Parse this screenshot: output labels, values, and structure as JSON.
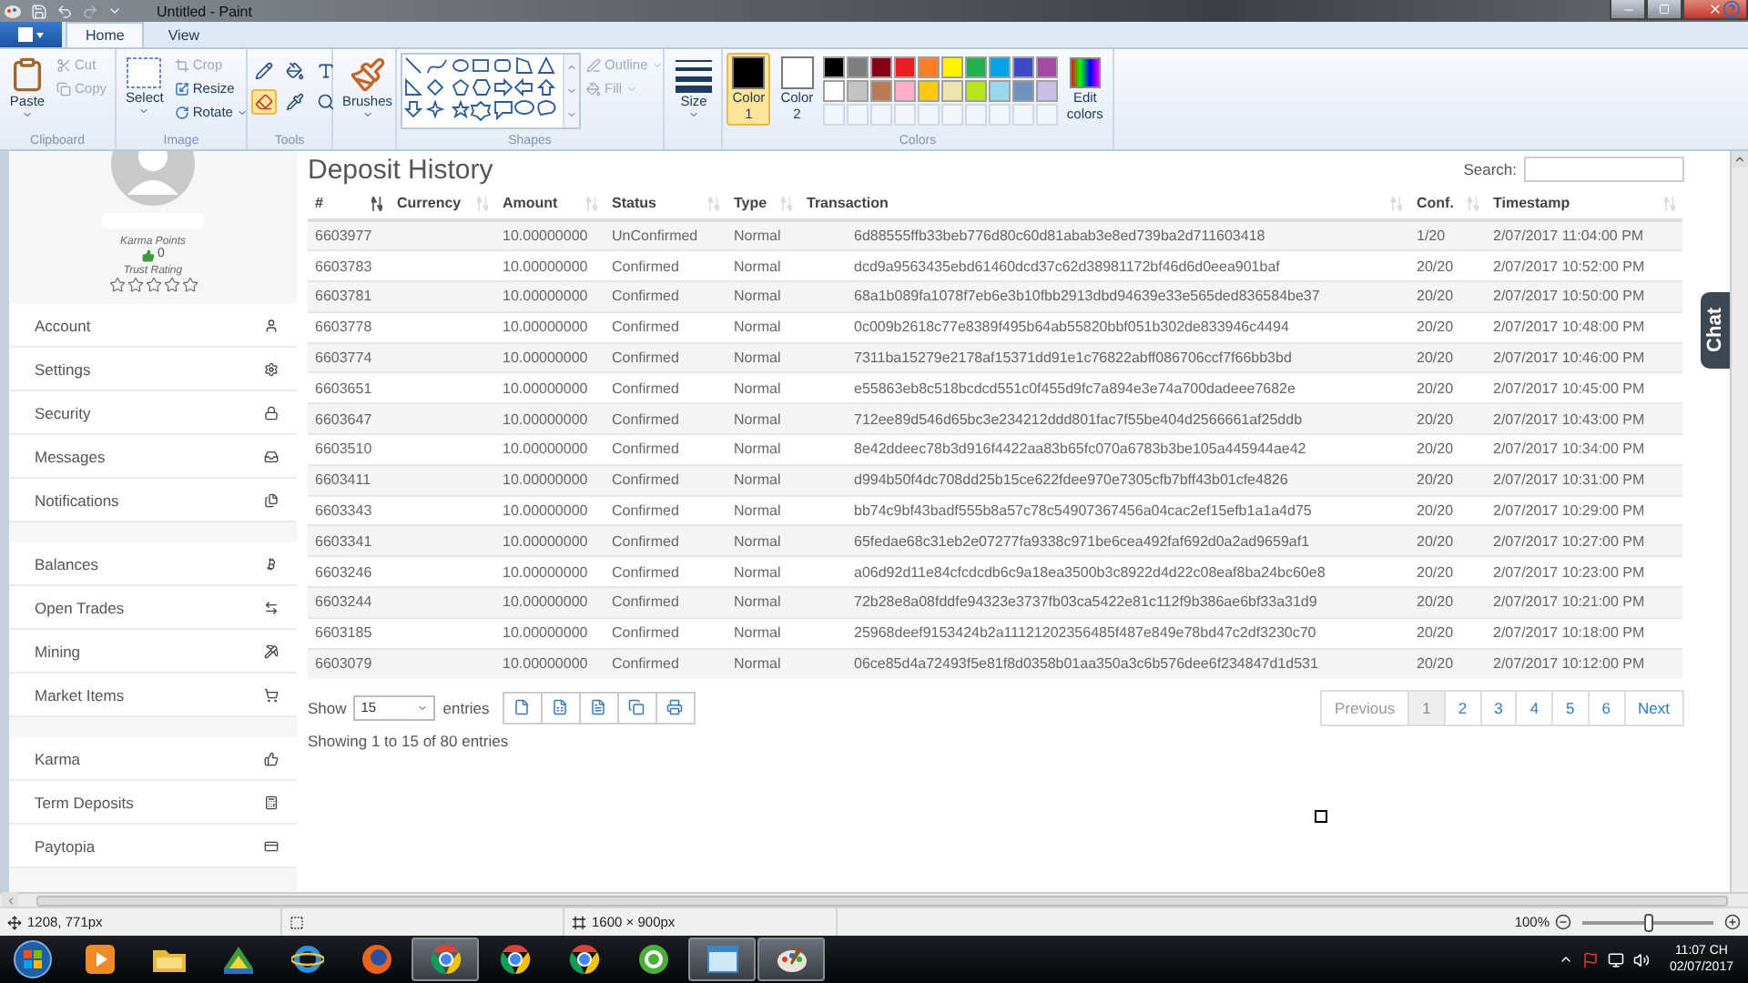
{
  "window": {
    "title": "Untitled - Paint"
  },
  "tabs": [
    {
      "label": "Home",
      "selected": true
    },
    {
      "label": "View",
      "selected": false
    }
  ],
  "ribbon": {
    "clipboard": {
      "label": "Clipboard",
      "paste": "Paste",
      "cut": {
        "label": "Cut",
        "disabled": true
      },
      "copy": {
        "label": "Copy",
        "disabled": true
      }
    },
    "image": {
      "label": "Image",
      "select": "Select",
      "crop": "Crop",
      "resize": "Resize",
      "rotate": "Rotate"
    },
    "tools": {
      "label": "Tools",
      "items": [
        {
          "kind": "pencil",
          "selected": false
        },
        {
          "kind": "fill",
          "selected": false
        },
        {
          "kind": "text",
          "selected": false
        },
        {
          "kind": "eraser",
          "selected": true
        },
        {
          "kind": "picker",
          "selected": false
        },
        {
          "kind": "magnifier",
          "selected": false
        }
      ]
    },
    "brushes": "Brushes",
    "shapes": {
      "label": "Shapes",
      "outline": {
        "label": "Outline",
        "disabled": true
      },
      "fill": {
        "label": "Fill",
        "disabled": true
      }
    },
    "size": "Size",
    "colors": {
      "label": "Colors",
      "color1": {
        "label": "Color 1",
        "color": "#000000",
        "selected": true
      },
      "color2": {
        "label": "Color 2",
        "color": "#ffffff",
        "selected": false
      },
      "palette": [
        {
          "color": "#000000"
        },
        {
          "color": "#7f7f7f"
        },
        {
          "color": "#880015"
        },
        {
          "color": "#ed1c24"
        },
        {
          "color": "#ff7f27"
        },
        {
          "color": "#fff200"
        },
        {
          "color": "#22b14c"
        },
        {
          "color": "#00a2e8"
        },
        {
          "color": "#3f48cc"
        },
        {
          "color": "#a349a4"
        },
        {
          "color": "#ffffff"
        },
        {
          "color": "#c3c3c3"
        },
        {
          "color": "#b97a57"
        },
        {
          "color": "#ffaec9"
        },
        {
          "color": "#ffc90e"
        },
        {
          "color": "#efe4b0"
        },
        {
          "color": "#b5e61d"
        },
        {
          "color": "#99d9ea"
        },
        {
          "color": "#7092be"
        },
        {
          "color": "#c8bfe7"
        }
      ],
      "edit": "Edit colors"
    }
  },
  "page": {
    "title": "Deposit History",
    "search_label": "Search:",
    "sidebar": {
      "karma": {
        "label": "Karma Points",
        "value": "0"
      },
      "trust": {
        "label": "Trust Rating",
        "stars": 0
      },
      "menu_groups": [
        {
          "items": [
            {
              "label": "Account",
              "kind": "user"
            },
            {
              "label": "Settings",
              "kind": "settings"
            },
            {
              "label": "Security",
              "kind": "security"
            },
            {
              "label": "Messages",
              "kind": "messages"
            },
            {
              "label": "Notifications",
              "kind": "notifications"
            }
          ]
        },
        {
          "items": [
            {
              "label": "Balances",
              "kind": "balances"
            },
            {
              "label": "Open Trades",
              "kind": "trades"
            },
            {
              "label": "Mining",
              "kind": "mining"
            },
            {
              "label": "Market Items",
              "kind": "market"
            }
          ]
        },
        {
          "items": [
            {
              "label": "Karma",
              "kind": "karma"
            },
            {
              "label": "Term Deposits",
              "kind": "deposits"
            },
            {
              "label": "Paytopia",
              "kind": "paytopia"
            }
          ]
        }
      ]
    },
    "table": {
      "columns": [
        {
          "label": "#",
          "sorted": true
        },
        {
          "label": "Currency",
          "sorted": false
        },
        {
          "label": "Amount",
          "sorted": false
        },
        {
          "label": "Status",
          "sorted": false
        },
        {
          "label": "Type",
          "sorted": false
        },
        {
          "label": "Transaction",
          "sorted": false
        },
        {
          "label": "Conf.",
          "sorted": false
        },
        {
          "label": "Timestamp",
          "sorted": false
        }
      ],
      "rows": [
        {
          "id": "6603977",
          "amount": "10.00000000",
          "status": "UnConfirmed",
          "type": "Normal",
          "transaction": "6d88555ffb33beb776d80c60d81abab3e8ed739ba2d711603418",
          "conf": "1/20",
          "timestamp": "2/07/2017 11:04:00 PM"
        },
        {
          "id": "6603783",
          "amount": "10.00000000",
          "status": "Confirmed",
          "type": "Normal",
          "transaction": "dcd9a9563435ebd61460dcd37c62d38981172bf46d6d0eea901baf",
          "conf": "20/20",
          "timestamp": "2/07/2017 10:52:00 PM"
        },
        {
          "id": "6603781",
          "amount": "10.00000000",
          "status": "Confirmed",
          "type": "Normal",
          "transaction": "68a1b089fa1078f7eb6e3b10fbb2913dbd94639e33e565ded836584be37",
          "conf": "20/20",
          "timestamp": "2/07/2017 10:50:00 PM"
        },
        {
          "id": "6603778",
          "amount": "10.00000000",
          "status": "Confirmed",
          "type": "Normal",
          "transaction": "0c009b2618c77e8389f495b64ab55820bbf051b302de833946c4494",
          "conf": "20/20",
          "timestamp": "2/07/2017 10:48:00 PM"
        },
        {
          "id": "6603774",
          "amount": "10.00000000",
          "status": "Confirmed",
          "type": "Normal",
          "transaction": "7311ba15279e2178af15371dd91e1c76822abff086706ccf7f66bb3bd",
          "conf": "20/20",
          "timestamp": "2/07/2017 10:46:00 PM"
        },
        {
          "id": "6603651",
          "amount": "10.00000000",
          "status": "Confirmed",
          "type": "Normal",
          "transaction": "e55863eb8c518bcdcd551c0f455d9fc7a894e3e74a700dadeee7682e",
          "conf": "20/20",
          "timestamp": "2/07/2017 10:45:00 PM"
        },
        {
          "id": "6603647",
          "amount": "10.00000000",
          "status": "Confirmed",
          "type": "Normal",
          "transaction": "712ee89d546d65bc3e234212ddd801fac7f55be404d2566661af25ddb",
          "conf": "20/20",
          "timestamp": "2/07/2017 10:43:00 PM"
        },
        {
          "id": "6603510",
          "amount": "10.00000000",
          "status": "Confirmed",
          "type": "Normal",
          "transaction": "8e42ddeec78b3d916f4422aa83b65fc070a6783b3be105a445944ae42",
          "conf": "20/20",
          "timestamp": "2/07/2017 10:34:00 PM"
        },
        {
          "id": "6603411",
          "amount": "10.00000000",
          "status": "Confirmed",
          "type": "Normal",
          "transaction": "d994b50f4dc708dd25b15ce622fdee970e7305cfb7bff43b01cfe4826",
          "conf": "20/20",
          "timestamp": "2/07/2017 10:31:00 PM"
        },
        {
          "id": "6603343",
          "amount": "10.00000000",
          "status": "Confirmed",
          "type": "Normal",
          "transaction": "bb74c9bf43badf555b8a57c78c54907367456a04cac2ef15efb1a1a4d75",
          "conf": "20/20",
          "timestamp": "2/07/2017 10:29:00 PM"
        },
        {
          "id": "6603341",
          "amount": "10.00000000",
          "status": "Confirmed",
          "type": "Normal",
          "transaction": "65fedae68c31eb2e07277fa9338c971be6cea492faf692d0a2ad9659af1",
          "conf": "20/20",
          "timestamp": "2/07/2017 10:27:00 PM"
        },
        {
          "id": "6603246",
          "amount": "10.00000000",
          "status": "Confirmed",
          "type": "Normal",
          "transaction": "a06d92d11e84cfcdcdb6c9a18ea3500b3c8922d4d22c08eaf8ba24bc60e8",
          "conf": "20/20",
          "timestamp": "2/07/2017 10:23:00 PM"
        },
        {
          "id": "6603244",
          "amount": "10.00000000",
          "status": "Confirmed",
          "type": "Normal",
          "transaction": "72b28e8a08fddfe94323e3737fb03ca5422e81c112f9b386ae6bf33a31d9",
          "conf": "20/20",
          "timestamp": "2/07/2017 10:21:00 PM"
        },
        {
          "id": "6603185",
          "amount": "10.00000000",
          "status": "Confirmed",
          "type": "Normal",
          "transaction": "25968deef9153424b2a11121202356485f487e849e78bd47c2df3230c70",
          "conf": "20/20",
          "timestamp": "2/07/2017 10:18:00 PM"
        },
        {
          "id": "6603079",
          "amount": "10.00000000",
          "status": "Confirmed",
          "type": "Normal",
          "transaction": "06ce85d4a72493f5e81f8d0358b01aa350a3c6b576dee6f234847d1d531",
          "conf": "20/20",
          "timestamp": "2/07/2017 10:12:00 PM"
        }
      ]
    },
    "length": {
      "before": "Show",
      "value": "15",
      "after": "entries"
    },
    "exports": [
      {
        "kind": "file"
      },
      {
        "kind": "sheet"
      },
      {
        "kind": "doc"
      },
      {
        "kind": "copy"
      },
      {
        "kind": "print"
      }
    ],
    "info": "Showing 1 to 15 of 80 entries",
    "pagination": [
      {
        "label": "Previous",
        "selected": false,
        "disabled": true
      },
      {
        "label": "1",
        "selected": true,
        "disabled": false
      },
      {
        "label": "2",
        "selected": false,
        "disabled": false
      },
      {
        "label": "3",
        "selected": false,
        "disabled": false
      },
      {
        "label": "4",
        "selected": false,
        "disabled": false
      },
      {
        "label": "5",
        "selected": false,
        "disabled": false
      },
      {
        "label": "6",
        "selected": false,
        "disabled": false
      },
      {
        "label": "Next",
        "selected": false,
        "disabled": false
      }
    ],
    "chat": "Chat"
  },
  "status_bar": {
    "cursor": "1208, 771px",
    "size": "1600 × 900px",
    "zoom": "100%",
    "zoom_slider": {
      "level": 0.5
    }
  },
  "taskbar": {
    "apps": [
      {
        "kind": "media",
        "active": false
      },
      {
        "kind": "folder",
        "active": false
      },
      {
        "kind": "tool",
        "active": false
      },
      {
        "kind": "ie",
        "active": false
      },
      {
        "kind": "firefox",
        "active": false
      },
      {
        "kind": "chrome",
        "active": true
      },
      {
        "kind": "chrome",
        "active": false
      },
      {
        "kind": "chrome",
        "active": false
      },
      {
        "kind": "green",
        "active": false
      },
      {
        "kind": "window",
        "active": true
      },
      {
        "kind": "paint",
        "active": true
      }
    ],
    "time": "11:07 CH",
    "date": "02/07/2017"
  }
}
